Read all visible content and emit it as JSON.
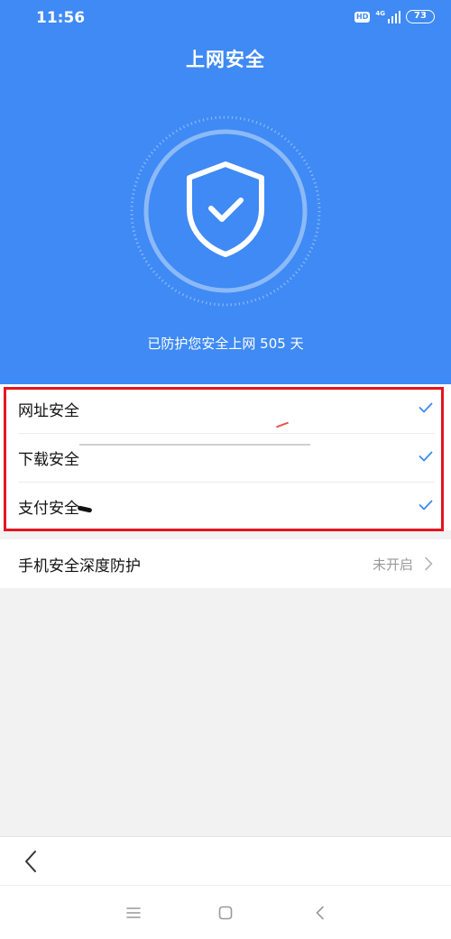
{
  "status_bar": {
    "time": "11:56",
    "hd": "HD",
    "network": "4G",
    "battery": "73"
  },
  "header": {
    "title": "上网安全",
    "protect_text": "已防护您安全上网 505 天"
  },
  "icons": {
    "shield": "shield-check-icon",
    "check": "check-icon",
    "chevron": "chevron-right-icon",
    "back": "back-arrow-icon"
  },
  "colors": {
    "brand_blue": "#3f8af4",
    "check_blue": "#3f8af4",
    "highlight_red": "#e4161f"
  },
  "security_items": [
    {
      "label": "网址安全"
    },
    {
      "label": "下载安全"
    },
    {
      "label": "支付安全"
    }
  ],
  "deep_protection": {
    "label": "手机安全深度防护",
    "status": "未开启"
  }
}
